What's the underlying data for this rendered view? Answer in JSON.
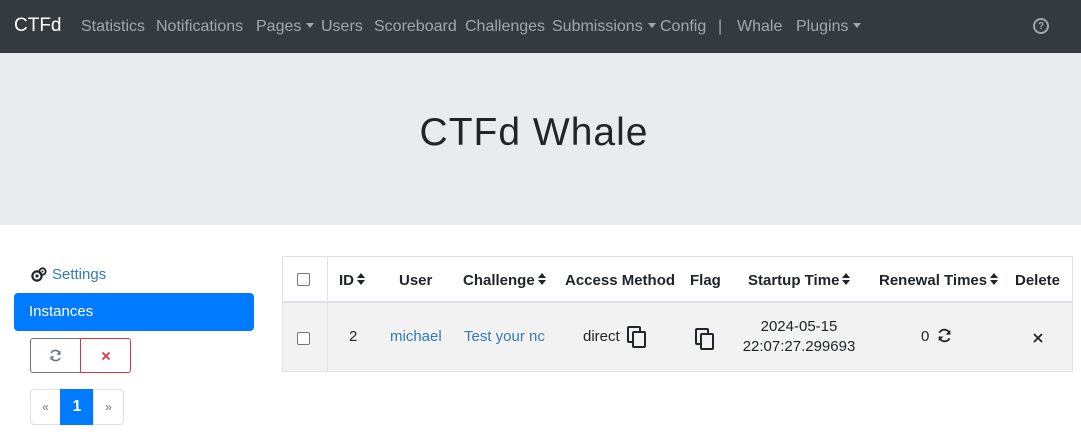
{
  "navbar": {
    "brand": "CTFd",
    "items": [
      {
        "label": "Statistics"
      },
      {
        "label": "Notifications"
      },
      {
        "label": "Pages"
      },
      {
        "label": "Users"
      },
      {
        "label": "Scoreboard"
      },
      {
        "label": "Challenges"
      },
      {
        "label": "Submissions"
      },
      {
        "label": "Config"
      },
      {
        "label": "|"
      },
      {
        "label": "Whale"
      },
      {
        "label": "Plugins"
      }
    ],
    "help_icon": "question-circle-icon"
  },
  "jumbotron": {
    "title": "CTFd Whale"
  },
  "sidebar": {
    "settings_label": "Settings",
    "instances_label": "Instances",
    "renew_icon": "refresh-icon",
    "delete_icon": "close-icon",
    "pagination": {
      "prev": "«",
      "current": "1",
      "next": "»"
    }
  },
  "table": {
    "headers": {
      "id": "ID",
      "user": "User",
      "challenge": "Challenge",
      "access_method": "Access Method",
      "flag": "Flag",
      "startup_time": "Startup Time",
      "renewal_times": "Renewal Times",
      "delete": "Delete"
    },
    "rows": [
      {
        "id": "2",
        "user": "michael",
        "challenge": "Test your nc",
        "access_method": "direct",
        "startup_date": "2024-05-15",
        "startup_clock": "22:07:27.299693",
        "renewal_times": "0"
      }
    ]
  },
  "colors": {
    "navbar_bg": "#343a40",
    "jumbotron_bg": "#e9ecef",
    "primary": "#007bff",
    "link": "#337ab7",
    "danger": "#dc3545"
  }
}
